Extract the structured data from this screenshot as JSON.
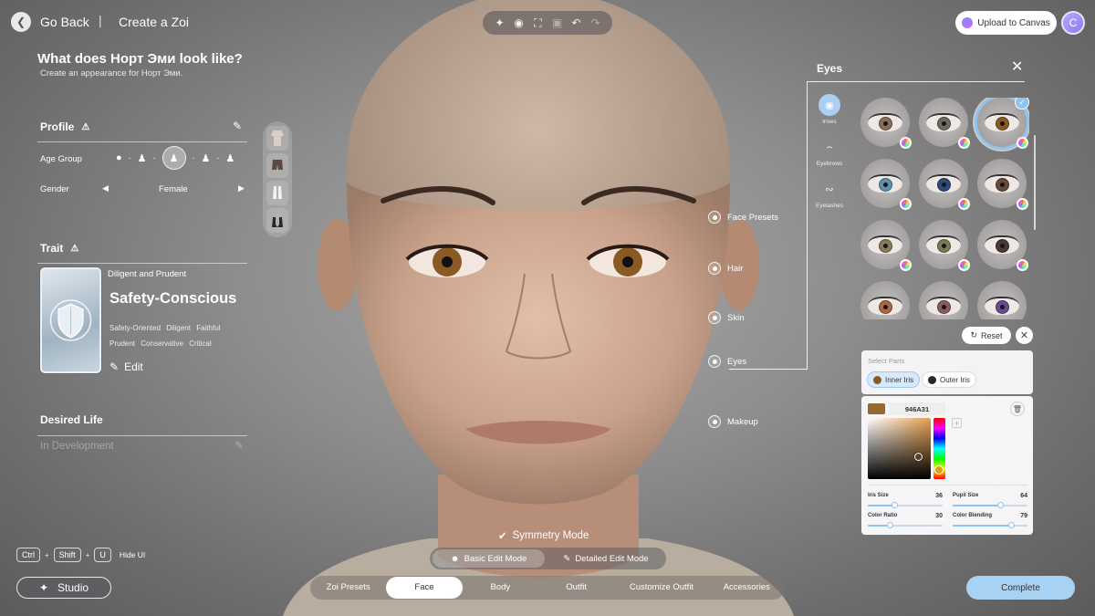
{
  "header": {
    "back_label": "Go Back",
    "separator": "|",
    "crumb": "Create a Zoi",
    "upload_label": "Upload to Canvas",
    "avatar_letter": "C"
  },
  "toolbar": {
    "icons": [
      "sparkle-icon",
      "camera-icon",
      "focus-icon",
      "crop-icon",
      "undo-icon",
      "redo-icon"
    ]
  },
  "intro": {
    "title": "What does Норт Эми look like?",
    "subtitle": "Create an appearance for Норт Эми."
  },
  "profile": {
    "title": "Profile",
    "age_label": "Age Group",
    "gender_label": "Gender",
    "gender_value": "Female"
  },
  "trait": {
    "title": "Trait",
    "kicker": "Diligent and Prudent",
    "name": "Safety-Conscious",
    "tags": [
      "Safety-Oriented",
      "Diligent",
      "Faithful",
      "Prudent",
      "Conservative",
      "Critical"
    ],
    "edit_label": "Edit"
  },
  "desired_life": {
    "title": "Desired Life",
    "status": "In Development"
  },
  "regions": {
    "face_presets": "Face Presets",
    "hair": "Hair",
    "skin": "Skin",
    "eyes": "Eyes",
    "makeup": "Makeup"
  },
  "eyes_panel": {
    "title": "Eyes",
    "tabs": [
      {
        "label": "Irises",
        "icon": "iris-icon"
      },
      {
        "label": "Eyebrows",
        "icon": "eyebrow-icon"
      },
      {
        "label": "Eyelashes",
        "icon": "eyelash-icon"
      }
    ],
    "iris_presets": [
      "#8a6e5a",
      "#6d6a60",
      "#8a5a24",
      "#5f8fb0",
      "#2f4a7a",
      "#6a4a3a",
      "#8a7a55",
      "#7a7a50",
      "#4a3a35",
      "#a86a40",
      "#8a5a60",
      "#6a4a90"
    ],
    "selected_index": 2,
    "reset_label": "Reset"
  },
  "parts": {
    "label": "Select Parts",
    "inner": {
      "label": "Inner Iris",
      "color": "#8a5a24"
    },
    "outer": {
      "label": "Outer Iris",
      "color": "#2a2a20"
    }
  },
  "color": {
    "hex": "946A31",
    "sliders": [
      {
        "label": "Iris Size",
        "value": "36",
        "fraction": 0.36
      },
      {
        "label": "Pupil Size",
        "value": "64",
        "fraction": 0.64
      },
      {
        "label": "Color Ratio",
        "value": "30",
        "fraction": 0.3
      },
      {
        "label": "Color Blending",
        "value": "79",
        "fraction": 0.79
      }
    ]
  },
  "bottom": {
    "symmetry": "Symmetry Mode",
    "basic_mode": "Basic Edit Mode",
    "detailed_mode": "Detailed Edit Mode",
    "shortcut_keys": [
      "Ctrl",
      "Shift",
      "U"
    ],
    "shortcut_action": "Hide UI",
    "studio": "Studio",
    "tabs": [
      "Zoi Presets",
      "Face",
      "Body",
      "Outfit",
      "Customize Outfit",
      "Accessories"
    ],
    "active_tab": "Face",
    "complete": "Complete"
  }
}
